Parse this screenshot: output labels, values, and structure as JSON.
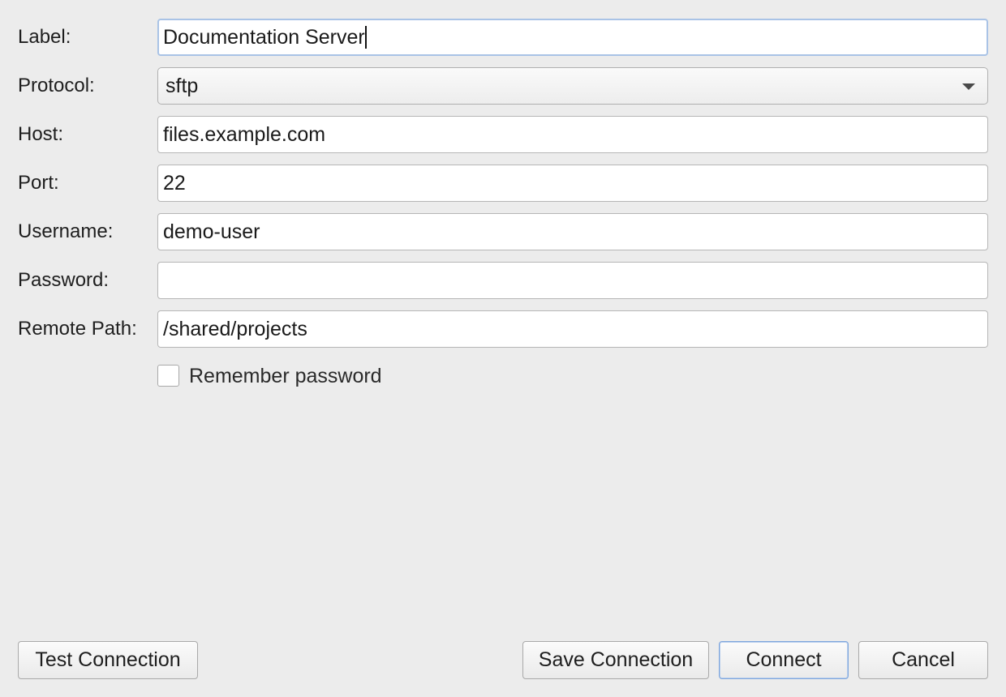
{
  "form": {
    "label": {
      "label": "Label:",
      "value": "Documentation Server"
    },
    "protocol": {
      "label": "Protocol:",
      "value": "sftp"
    },
    "host": {
      "label": "Host:",
      "value": "files.example.com"
    },
    "port": {
      "label": "Port:",
      "value": "22"
    },
    "username": {
      "label": "Username:",
      "value": "demo-user"
    },
    "password": {
      "label": "Password:",
      "value": ""
    },
    "remote_path": {
      "label": "Remote Path:",
      "value": "/shared/projects"
    },
    "remember_password": {
      "label": "Remember password",
      "checked": false
    }
  },
  "buttons": {
    "test_connection": "Test Connection",
    "save_connection": "Save Connection",
    "connect": "Connect",
    "cancel": "Cancel"
  },
  "icons": {
    "protocol_dropdown": "chevron-down-icon"
  },
  "colors": {
    "background": "#ececec",
    "focus_ring": "#a9c3e6",
    "default_button_border": "#7ea6dd"
  }
}
